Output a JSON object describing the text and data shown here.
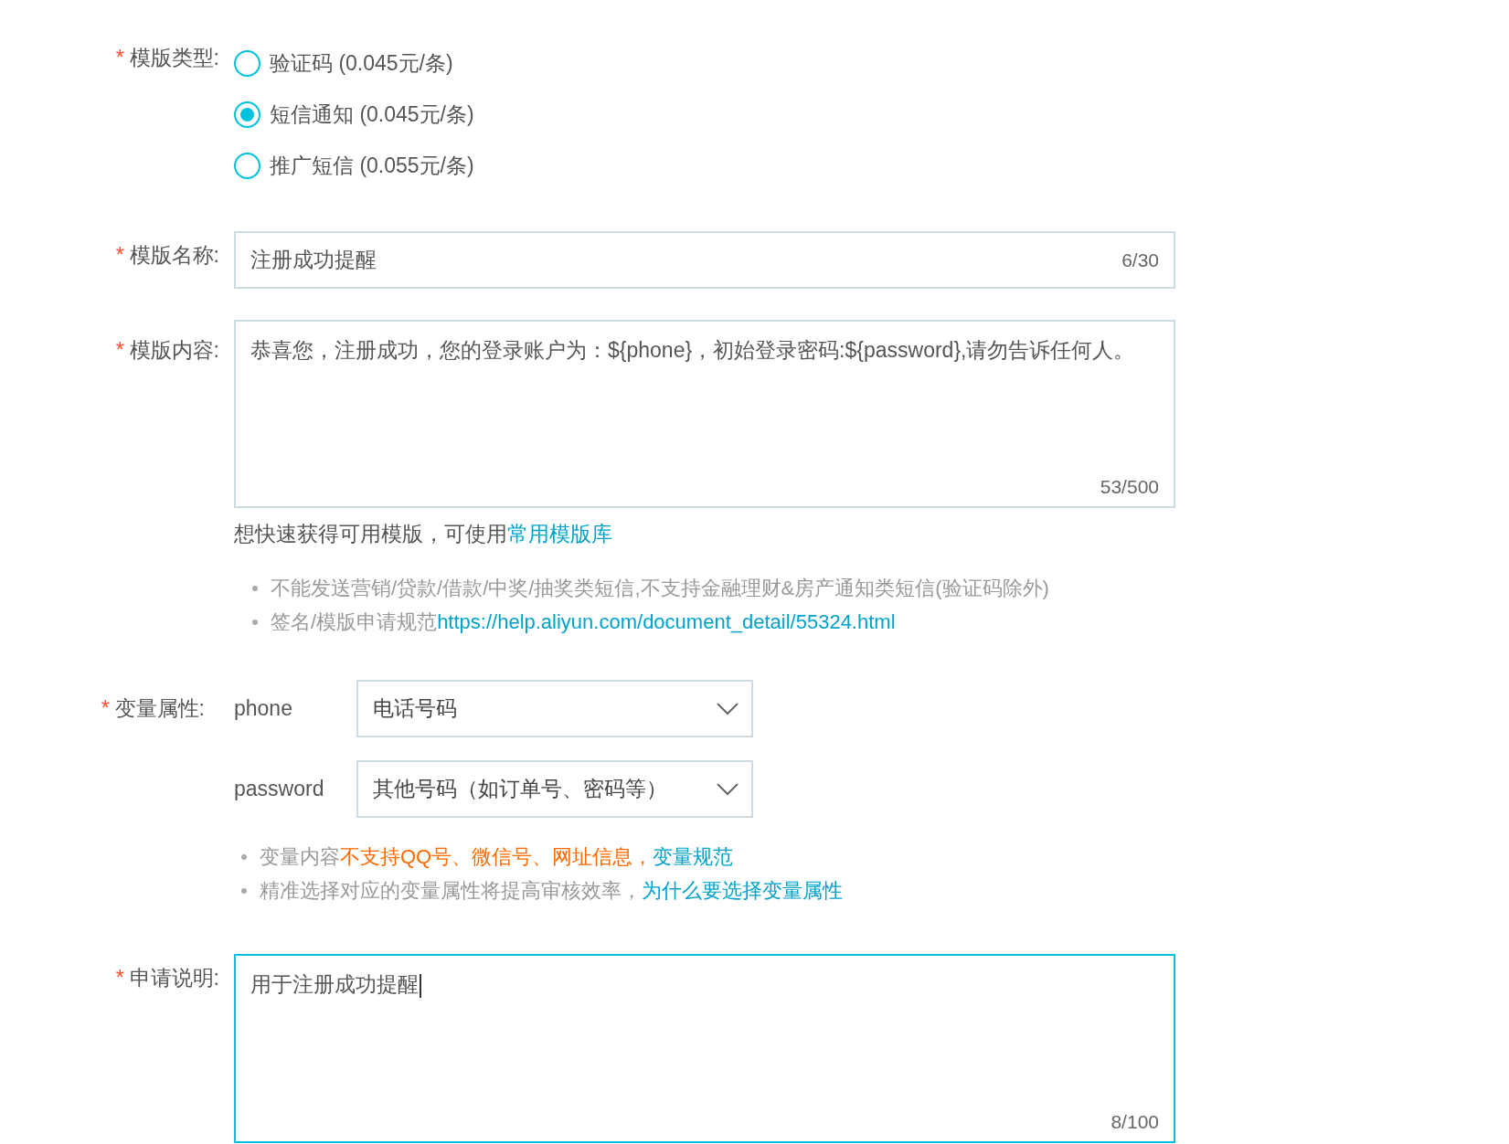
{
  "template_type": {
    "required_mark": "*",
    "label": "模版类型:",
    "options": [
      {
        "label": "验证码 (0.045元/条)",
        "selected": false
      },
      {
        "label": "短信通知 (0.045元/条)",
        "selected": true
      },
      {
        "label": "推广短信 (0.055元/条)",
        "selected": false
      }
    ]
  },
  "template_name": {
    "required_mark": "*",
    "label": "模版名称:",
    "value": "注册成功提醒",
    "counter": "6/30"
  },
  "template_content": {
    "required_mark": "*",
    "label": "模版内容:",
    "value": "恭喜您，注册成功，您的登录账户为：${phone}，初始登录密码:${password},请勿告诉任何人。",
    "counter": "53/500"
  },
  "template_hint": {
    "text": "想快速获得可用模版，可使用",
    "link": "常用模版库"
  },
  "content_notes": [
    {
      "segments": [
        {
          "kind": "plain",
          "text": "不能发送营销/贷款/借款/中奖/抽奖类短信,不支持金融理财&房产通知类短信(验证码除外)"
        }
      ]
    },
    {
      "segments": [
        {
          "kind": "plain",
          "text": "签名/模版申请规范 "
        },
        {
          "kind": "link",
          "text": "https://help.aliyun.com/document_detail/55324.html"
        }
      ]
    }
  ],
  "variables": {
    "required_mark": "*",
    "label": "变量属性:",
    "rows": [
      {
        "name": "phone",
        "value": "电话号码"
      },
      {
        "name": "password",
        "value": "其他号码（如订单号、密码等）"
      }
    ]
  },
  "variable_notes": [
    {
      "segments": [
        {
          "kind": "plain",
          "text": "变量内容"
        },
        {
          "kind": "warning",
          "text": "不支持QQ号、微信号、网址信息，"
        },
        {
          "kind": "link",
          "text": "变量规范"
        }
      ]
    },
    {
      "segments": [
        {
          "kind": "plain",
          "text": "精准选择对应的变量属性将提高审核效率，"
        },
        {
          "kind": "link",
          "text": "为什么要选择变量属性"
        }
      ]
    }
  ],
  "application": {
    "required_mark": "*",
    "label": "申请说明:",
    "value": "用于注册成功提醒",
    "counter": "8/100",
    "focused": true
  }
}
